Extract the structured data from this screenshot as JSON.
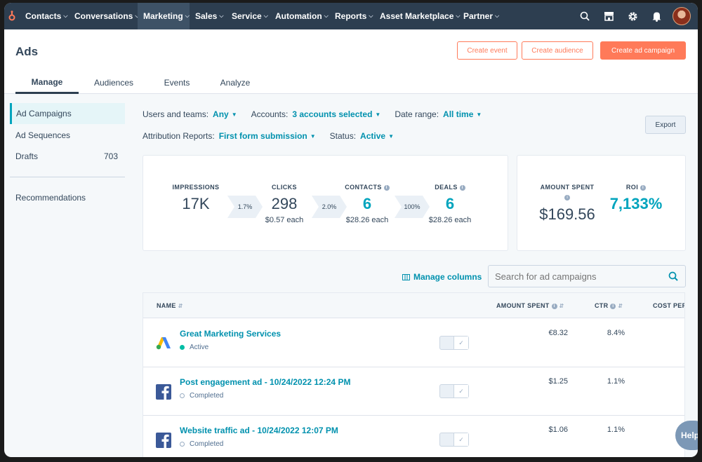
{
  "nav": {
    "items": [
      {
        "label": "Contacts"
      },
      {
        "label": "Conversations"
      },
      {
        "label": "Marketing"
      },
      {
        "label": "Sales"
      },
      {
        "label": "Service"
      },
      {
        "label": "Automation"
      },
      {
        "label": "Reports"
      },
      {
        "label": "Asset Marketplace"
      },
      {
        "label": "Partner"
      }
    ],
    "active": "Marketing",
    "icons": [
      "search-icon",
      "marketplace-icon",
      "settings-gear-icon",
      "notifications-bell-icon",
      "user-avatar"
    ]
  },
  "header": {
    "title": "Ads",
    "buttons": {
      "create_event": "Create event",
      "create_audience": "Create audience",
      "create_campaign": "Create ad campaign"
    },
    "tabs": [
      {
        "label": "Manage"
      },
      {
        "label": "Audiences"
      },
      {
        "label": "Events"
      },
      {
        "label": "Analyze"
      }
    ],
    "active_tab": "Manage"
  },
  "sidebar": {
    "items": [
      {
        "label": "Ad Campaigns",
        "count": ""
      },
      {
        "label": "Ad Sequences",
        "count": ""
      },
      {
        "label": "Drafts",
        "count": "703"
      }
    ],
    "recommendations": "Recommendations"
  },
  "filters": {
    "users_label": "Users and teams:",
    "users_value": "Any",
    "accounts_label": "Accounts:",
    "accounts_value": "3 accounts selected",
    "date_label": "Date range:",
    "date_value": "All time",
    "attribution_label": "Attribution Reports:",
    "attribution_value": "First form submission",
    "status_label": "Status:",
    "status_value": "Active",
    "export": "Export"
  },
  "stats": {
    "impressions": {
      "label": "IMPRESSIONS",
      "value": "17K"
    },
    "rate1": "1.7%",
    "clicks": {
      "label": "CLICKS",
      "value": "298",
      "sub": "$0.57 each"
    },
    "rate2": "2.0%",
    "contacts": {
      "label": "CONTACTS",
      "value": "6",
      "sub": "$28.26 each"
    },
    "rate3": "100%",
    "deals": {
      "label": "DEALS",
      "value": "6",
      "sub": "$28.26 each"
    },
    "amount_spent": {
      "label": "AMOUNT SPENT",
      "value": "$169.56"
    },
    "roi": {
      "label": "ROI",
      "value": "7,133%"
    }
  },
  "table": {
    "manage_columns": "Manage columns",
    "search_placeholder": "Search for ad campaigns",
    "columns": {
      "name": "NAME",
      "amount_spent": "AMOUNT SPENT",
      "ctr": "CTR",
      "cost_per": "COST PER"
    },
    "rows": [
      {
        "name": "Great Marketing Services",
        "status": "Active",
        "network": "google-ads-logo",
        "spent": "€8.32",
        "ctr": "8.4%"
      },
      {
        "name": "Post engagement ad - 10/24/2022 12:24 PM",
        "status": "Completed",
        "network": "facebook-logo",
        "spent": "$1.25",
        "ctr": "1.1%"
      },
      {
        "name": "Website traffic ad - 10/24/2022 12:07 PM",
        "status": "Completed",
        "network": "facebook-logo",
        "spent": "$1.06",
        "ctr": "1.1%"
      }
    ]
  },
  "help": "Help",
  "colors": {
    "nav_bg": "#2d3e50",
    "accent_orange": "#ff7a59",
    "link_teal": "#0091ae",
    "stat_teal": "#00a4bd",
    "active_green": "#00bda5"
  }
}
